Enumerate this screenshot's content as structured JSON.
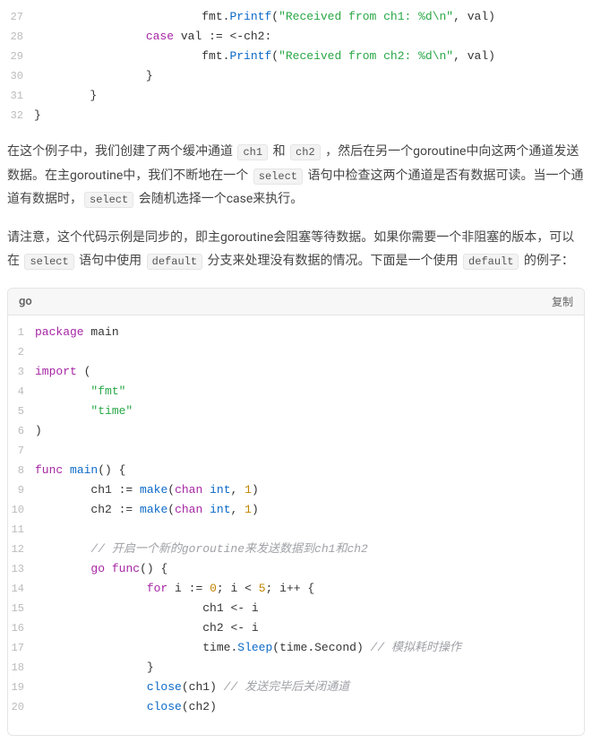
{
  "code_top": {
    "lines": [
      {
        "n": 27,
        "indent": 24,
        "tokens": [
          [
            "id",
            "fmt"
          ],
          [
            "op",
            "."
          ],
          [
            "fn",
            "Printf"
          ],
          [
            "op",
            "("
          ],
          [
            "str",
            "\"Received from ch1: %d\\n\""
          ],
          [
            "op",
            ", "
          ],
          [
            "id",
            "val"
          ],
          [
            "op",
            ")"
          ]
        ]
      },
      {
        "n": 28,
        "indent": 16,
        "tokens": [
          [
            "kw",
            "case"
          ],
          [
            "op",
            " "
          ],
          [
            "id",
            "val"
          ],
          [
            "op",
            " := <-"
          ],
          [
            "id",
            "ch2"
          ],
          [
            "op",
            ":"
          ]
        ]
      },
      {
        "n": 29,
        "indent": 24,
        "tokens": [
          [
            "id",
            "fmt"
          ],
          [
            "op",
            "."
          ],
          [
            "fn",
            "Printf"
          ],
          [
            "op",
            "("
          ],
          [
            "str",
            "\"Received from ch2: %d\\n\""
          ],
          [
            "op",
            ", "
          ],
          [
            "id",
            "val"
          ],
          [
            "op",
            ")"
          ]
        ]
      },
      {
        "n": 30,
        "indent": 16,
        "tokens": [
          [
            "op",
            "}"
          ]
        ]
      },
      {
        "n": 31,
        "indent": 8,
        "tokens": [
          [
            "op",
            "}"
          ]
        ]
      },
      {
        "n": 32,
        "indent": 0,
        "tokens": [
          [
            "op",
            "}"
          ]
        ]
      }
    ]
  },
  "para1": {
    "parts": [
      {
        "t": "text",
        "v": "在这个例子中，我们创建了两个缓冲通道 "
      },
      {
        "t": "code",
        "v": "ch1"
      },
      {
        "t": "text",
        "v": " 和 "
      },
      {
        "t": "code",
        "v": "ch2"
      },
      {
        "t": "text",
        "v": " ，然后在另一个goroutine中向这两个通道发送数据。在主goroutine中，我们不断地在一个 "
      },
      {
        "t": "code",
        "v": "select"
      },
      {
        "t": "text",
        "v": " 语句中检查这两个通道是否有数据可读。当一个通道有数据时，"
      },
      {
        "t": "code",
        "v": "select"
      },
      {
        "t": "text",
        "v": " 会随机选择一个case来执行。"
      }
    ]
  },
  "para2": {
    "parts": [
      {
        "t": "text",
        "v": "请注意，这个代码示例是同步的，即主goroutine会阻塞等待数据。如果你需要一个非阻塞的版本，可以在 "
      },
      {
        "t": "code",
        "v": "select"
      },
      {
        "t": "text",
        "v": " 语句中使用 "
      },
      {
        "t": "code",
        "v": "default"
      },
      {
        "t": "text",
        "v": " 分支来处理没有数据的情况。下面是一个使用 "
      },
      {
        "t": "code",
        "v": "default"
      },
      {
        "t": "text",
        "v": " 的例子："
      }
    ]
  },
  "card": {
    "lang": "go",
    "copy": "复制",
    "lines": [
      {
        "n": 1,
        "indent": 0,
        "tokens": [
          [
            "kw",
            "package"
          ],
          [
            "op",
            " "
          ],
          [
            "id",
            "main"
          ]
        ]
      },
      {
        "n": 2,
        "indent": 0,
        "tokens": []
      },
      {
        "n": 3,
        "indent": 0,
        "tokens": [
          [
            "kw",
            "import"
          ],
          [
            "op",
            " ("
          ]
        ]
      },
      {
        "n": 4,
        "indent": 8,
        "tokens": [
          [
            "str",
            "\"fmt\""
          ]
        ]
      },
      {
        "n": 5,
        "indent": 8,
        "tokens": [
          [
            "str",
            "\"time\""
          ]
        ]
      },
      {
        "n": 6,
        "indent": 0,
        "tokens": [
          [
            "op",
            ")"
          ]
        ]
      },
      {
        "n": 7,
        "indent": 0,
        "tokens": []
      },
      {
        "n": 8,
        "indent": 0,
        "tokens": [
          [
            "kw",
            "func"
          ],
          [
            "op",
            " "
          ],
          [
            "fn",
            "main"
          ],
          [
            "op",
            "() {"
          ]
        ]
      },
      {
        "n": 9,
        "indent": 8,
        "tokens": [
          [
            "id",
            "ch1"
          ],
          [
            "op",
            " := "
          ],
          [
            "fn",
            "make"
          ],
          [
            "op",
            "("
          ],
          [
            "kw",
            "chan"
          ],
          [
            "op",
            " "
          ],
          [
            "type",
            "int"
          ],
          [
            "op",
            ", "
          ],
          [
            "num",
            "1"
          ],
          [
            "op",
            ")"
          ]
        ]
      },
      {
        "n": 10,
        "indent": 8,
        "tokens": [
          [
            "id",
            "ch2"
          ],
          [
            "op",
            " := "
          ],
          [
            "fn",
            "make"
          ],
          [
            "op",
            "("
          ],
          [
            "kw",
            "chan"
          ],
          [
            "op",
            " "
          ],
          [
            "type",
            "int"
          ],
          [
            "op",
            ", "
          ],
          [
            "num",
            "1"
          ],
          [
            "op",
            ")"
          ]
        ]
      },
      {
        "n": 11,
        "indent": 0,
        "tokens": []
      },
      {
        "n": 12,
        "indent": 8,
        "tokens": [
          [
            "cm",
            "// 开启一个新的goroutine来发送数据到ch1和ch2"
          ]
        ]
      },
      {
        "n": 13,
        "indent": 8,
        "tokens": [
          [
            "kw",
            "go"
          ],
          [
            "op",
            " "
          ],
          [
            "kw",
            "func"
          ],
          [
            "op",
            "() {"
          ]
        ]
      },
      {
        "n": 14,
        "indent": 16,
        "tokens": [
          [
            "kw",
            "for"
          ],
          [
            "op",
            " "
          ],
          [
            "id",
            "i"
          ],
          [
            "op",
            " := "
          ],
          [
            "num",
            "0"
          ],
          [
            "op",
            "; "
          ],
          [
            "id",
            "i"
          ],
          [
            "op",
            " < "
          ],
          [
            "num",
            "5"
          ],
          [
            "op",
            "; "
          ],
          [
            "id",
            "i"
          ],
          [
            "op",
            "++ {"
          ]
        ]
      },
      {
        "n": 15,
        "indent": 24,
        "tokens": [
          [
            "id",
            "ch1"
          ],
          [
            "op",
            " <- "
          ],
          [
            "id",
            "i"
          ]
        ]
      },
      {
        "n": 16,
        "indent": 24,
        "tokens": [
          [
            "id",
            "ch2"
          ],
          [
            "op",
            " <- "
          ],
          [
            "id",
            "i"
          ]
        ]
      },
      {
        "n": 17,
        "indent": 24,
        "tokens": [
          [
            "id",
            "time"
          ],
          [
            "op",
            "."
          ],
          [
            "fn",
            "Sleep"
          ],
          [
            "op",
            "("
          ],
          [
            "id",
            "time"
          ],
          [
            "op",
            "."
          ],
          [
            "id",
            "Second"
          ],
          [
            "op",
            ") "
          ],
          [
            "cm",
            "// 模拟耗时操作"
          ]
        ]
      },
      {
        "n": 18,
        "indent": 16,
        "tokens": [
          [
            "op",
            "}"
          ]
        ]
      },
      {
        "n": 19,
        "indent": 16,
        "tokens": [
          [
            "fn",
            "close"
          ],
          [
            "op",
            "("
          ],
          [
            "id",
            "ch1"
          ],
          [
            "op",
            ") "
          ],
          [
            "cm",
            "// 发送完毕后关闭通道"
          ]
        ]
      },
      {
        "n": 20,
        "indent": 16,
        "tokens": [
          [
            "fn",
            "close"
          ],
          [
            "op",
            "("
          ],
          [
            "id",
            "ch2"
          ],
          [
            "op",
            ")"
          ]
        ]
      }
    ]
  }
}
